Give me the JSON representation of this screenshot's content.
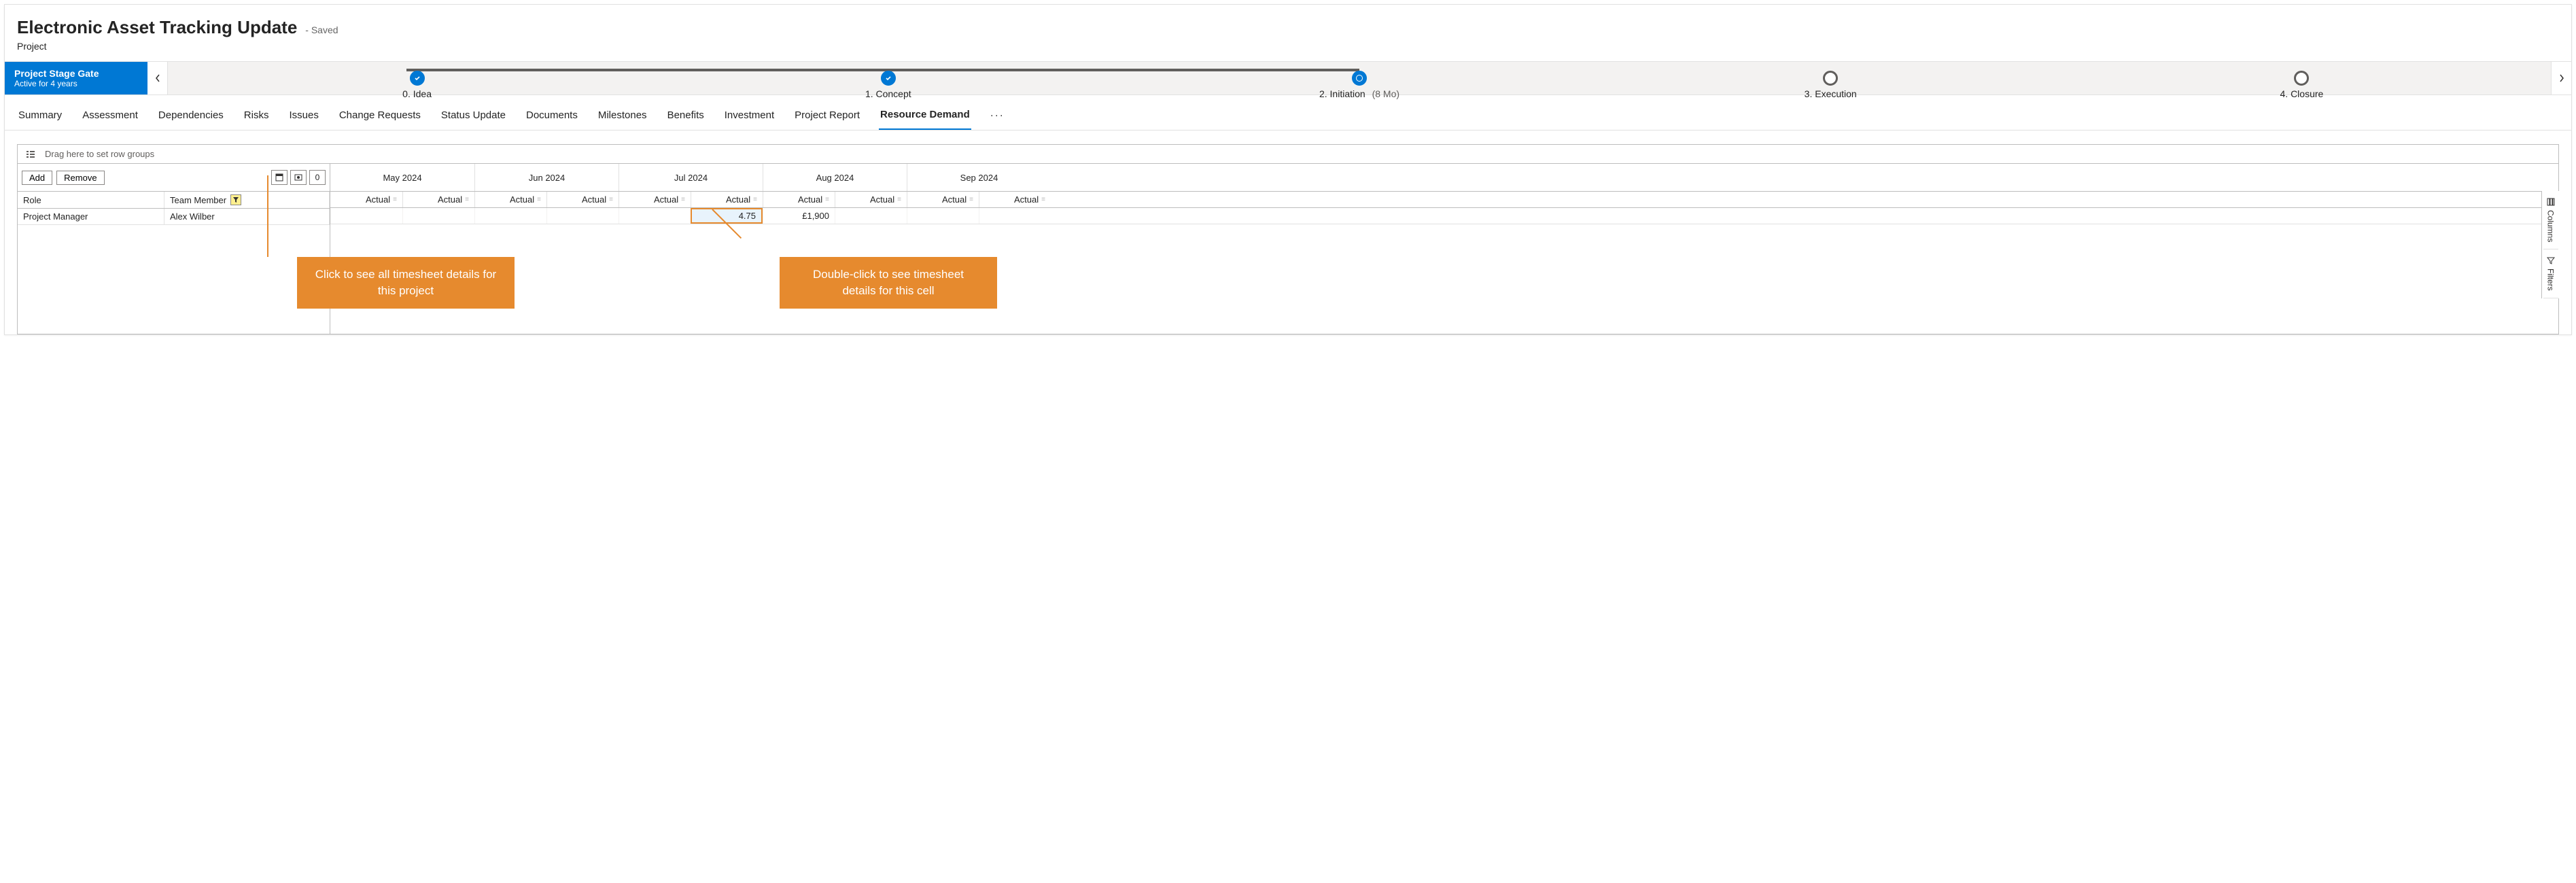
{
  "header": {
    "title": "Electronic Asset Tracking Update",
    "save_status": "- Saved",
    "subtitle": "Project"
  },
  "stage_gate": {
    "label": "Project Stage Gate",
    "active_text": "Active for 4 years",
    "stages": [
      {
        "label": "0. Idea",
        "state": "done"
      },
      {
        "label": "1. Concept",
        "state": "done"
      },
      {
        "label": "2. Initiation",
        "duration": "(8 Mo)",
        "state": "current"
      },
      {
        "label": "3. Execution",
        "state": "future"
      },
      {
        "label": "4. Closure",
        "state": "future"
      }
    ]
  },
  "tabs": [
    "Summary",
    "Assessment",
    "Dependencies",
    "Risks",
    "Issues",
    "Change Requests",
    "Status Update",
    "Documents",
    "Milestones",
    "Benefits",
    "Investment",
    "Project Report",
    "Resource Demand"
  ],
  "active_tab": "Resource Demand",
  "grid": {
    "group_placeholder": "Drag here to set row groups",
    "add_label": "Add",
    "remove_label": "Remove",
    "zero_label": "0",
    "col_role": "Role",
    "col_member": "Team Member",
    "actual_label": "Actual",
    "months": [
      "May 2024",
      "Jun 2024",
      "Jul 2024",
      "Aug 2024",
      "Sep 2024"
    ],
    "rows": [
      {
        "role": "Project Manager",
        "member": "Alex Wilber",
        "values": [
          "",
          "",
          "",
          "",
          "",
          "4.75",
          "£1,900",
          "",
          "",
          ""
        ]
      }
    ]
  },
  "side_tabs": {
    "columns": "Columns",
    "filters": "Filters"
  },
  "callouts": {
    "left": "Click to see all timesheet details for this project",
    "right": "Double-click to see timesheet details for this cell"
  }
}
